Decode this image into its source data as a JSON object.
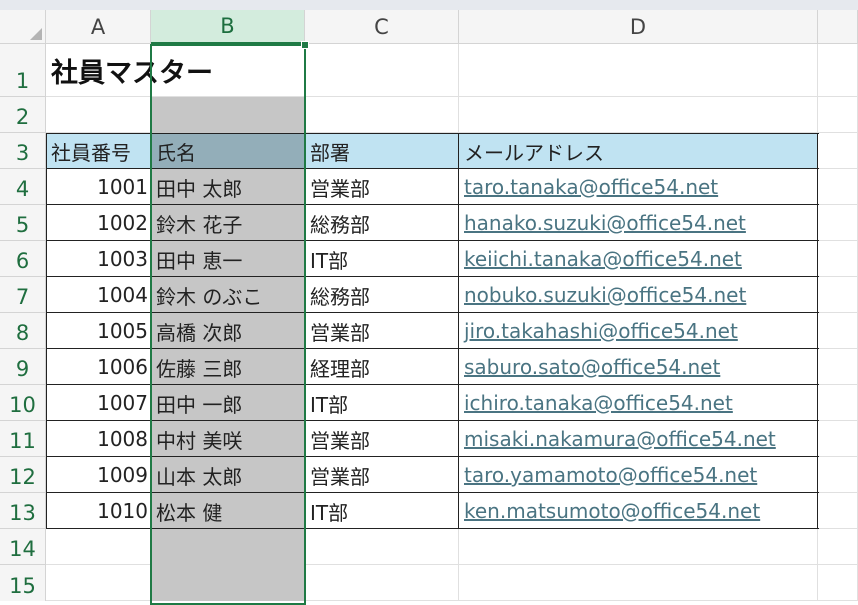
{
  "sheet": {
    "column_headers": [
      "A",
      "B",
      "C",
      "D"
    ],
    "row_headers": [
      "1",
      "2",
      "3",
      "4",
      "5",
      "6",
      "7",
      "8",
      "9",
      "10",
      "11",
      "12",
      "13",
      "14",
      "15"
    ],
    "selected_column": "B"
  },
  "content": {
    "title": "社員マスター",
    "table_headers": [
      "社員番号",
      "氏名",
      "部署",
      "メールアドレス"
    ],
    "rows": [
      {
        "id": "1001",
        "name": "田中 太郎",
        "dept": "営業部",
        "email": "taro.tanaka@office54.net"
      },
      {
        "id": "1002",
        "name": "鈴木 花子",
        "dept": "総務部",
        "email": "hanako.suzuki@office54.net"
      },
      {
        "id": "1003",
        "name": "田中 恵一",
        "dept": "IT部",
        "email": "keiichi.tanaka@office54.net"
      },
      {
        "id": "1004",
        "name": "鈴木 のぶこ",
        "dept": "総務部",
        "email": "nobuko.suzuki@office54.net"
      },
      {
        "id": "1005",
        "name": "高橋 次郎",
        "dept": "営業部",
        "email": "jiro.takahashi@office54.net"
      },
      {
        "id": "1006",
        "name": "佐藤 三郎",
        "dept": "経理部",
        "email": "saburo.sato@office54.net"
      },
      {
        "id": "1007",
        "name": "田中 一郎",
        "dept": "IT部",
        "email": "ichiro.tanaka@office54.net"
      },
      {
        "id": "1008",
        "name": "中村 美咲",
        "dept": "営業部",
        "email": "misaki.nakamura@office54.net"
      },
      {
        "id": "1009",
        "name": "山本 太郎",
        "dept": "営業部",
        "email": "taro.yamamoto@office54.net"
      },
      {
        "id": "1010",
        "name": "松本 健",
        "dept": "IT部",
        "email": "ken.matsumoto@office54.net"
      }
    ]
  },
  "colors": {
    "header_fill": "#c0e3f2",
    "selected_header_fill": "#93aeb9",
    "selection_fill": "#c6c6c6",
    "selection_border": "#1f7a45",
    "link": "#4a7482"
  }
}
